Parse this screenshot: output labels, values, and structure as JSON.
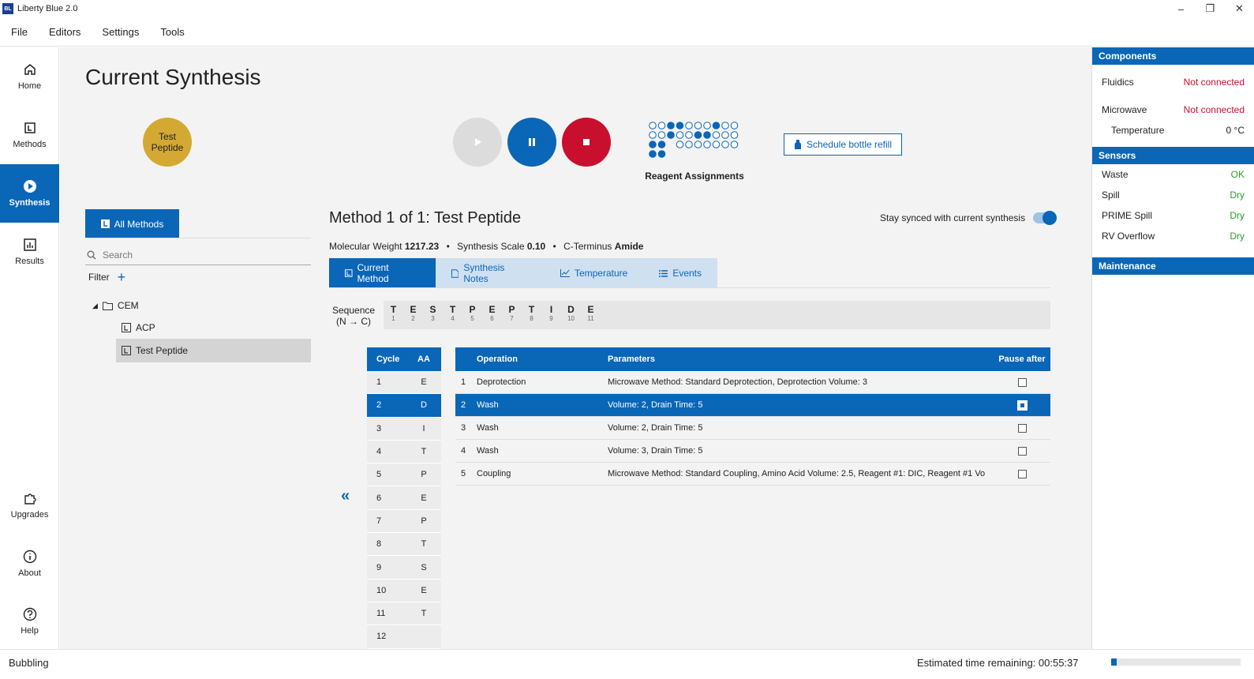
{
  "window": {
    "title": "Liberty Blue 2.0",
    "logo_text": "BL"
  },
  "menu": [
    "File",
    "Editors",
    "Settings",
    "Tools"
  ],
  "nav": [
    {
      "label": "Home",
      "icon": "home-icon"
    },
    {
      "label": "Methods",
      "icon": "method-icon"
    },
    {
      "label": "Synthesis",
      "icon": "play-circle-icon",
      "active": true
    },
    {
      "label": "Results",
      "icon": "bar-chart-icon"
    },
    {
      "label": "Upgrades",
      "icon": "puzzle-icon"
    },
    {
      "label": "About",
      "icon": "info-icon"
    },
    {
      "label": "Help",
      "icon": "help-icon"
    }
  ],
  "page": {
    "title": "Current Synthesis",
    "peptide_line1": "Test",
    "peptide_line2": "Peptide",
    "reagent_label": "Reagent Assignments",
    "refill_label": "Schedule bottle refill"
  },
  "methods": {
    "all_label": "All Methods",
    "search_placeholder": "Search",
    "filter_label": "Filter",
    "tree": {
      "folder": "CEM",
      "items": [
        "ACP",
        "Test Peptide"
      ],
      "selected": "Test Peptide"
    }
  },
  "method": {
    "title": "Method 1 of 1: Test Peptide",
    "sync_label": "Stay synced with current synthesis",
    "mw_label": "Molecular Weight",
    "mw_value": "1217.23",
    "scale_label": "Synthesis Scale",
    "scale_value": "0.10",
    "cterm_label": "C-Terminus",
    "cterm_value": "Amide",
    "tabs": [
      "Current Method",
      "Synthesis Notes",
      "Temperature",
      "Events"
    ]
  },
  "sequence": {
    "label_line1": "Sequence",
    "label_line2": "(N → C)",
    "residues": [
      "T",
      "E",
      "S",
      "T",
      "P",
      "E",
      "P",
      "T",
      "I",
      "D",
      "E"
    ],
    "positions": [
      "1",
      "2",
      "3",
      "4",
      "5",
      "6",
      "7",
      "8",
      "9",
      "10",
      "11"
    ]
  },
  "cycles": {
    "headers": [
      "Cycle",
      "AA"
    ],
    "rows": [
      [
        "1",
        "E"
      ],
      [
        "2",
        "D"
      ],
      [
        "3",
        "I"
      ],
      [
        "4",
        "T"
      ],
      [
        "5",
        "P"
      ],
      [
        "6",
        "E"
      ],
      [
        "7",
        "P"
      ],
      [
        "8",
        "T"
      ],
      [
        "9",
        "S"
      ],
      [
        "10",
        "E"
      ],
      [
        "11",
        "T"
      ],
      [
        "12",
        ""
      ]
    ],
    "selected_index": 1
  },
  "operations": {
    "headers": [
      "Operation",
      "Parameters",
      "Pause after"
    ],
    "rows": [
      {
        "n": "1",
        "op": "Deprotection",
        "params": "Microwave Method: Standard Deprotection, Deprotection Volume: 3"
      },
      {
        "n": "2",
        "op": "Wash",
        "params": "Volume: 2, Drain Time: 5"
      },
      {
        "n": "3",
        "op": "Wash",
        "params": "Volume: 2, Drain Time: 5"
      },
      {
        "n": "4",
        "op": "Wash",
        "params": "Volume: 3, Drain Time: 5"
      },
      {
        "n": "5",
        "op": "Coupling",
        "params": "Microwave Method: Standard Coupling, Amino Acid Volume: 2.5, Reagent #1: DIC, Reagent #1 Vo"
      }
    ],
    "selected_index": 1
  },
  "panel": {
    "components_title": "Components",
    "fluidics_label": "Fluidics",
    "fluidics_value": "Not connected",
    "microwave_label": "Microwave",
    "microwave_value": "Not connected",
    "temperature_label": "Temperature",
    "temperature_value": "0 °C",
    "sensors_title": "Sensors",
    "sensors": [
      {
        "label": "Waste",
        "value": "OK"
      },
      {
        "label": "Spill",
        "value": "Dry"
      },
      {
        "label": "PRIME Spill",
        "value": "Dry"
      },
      {
        "label": "RV Overflow",
        "value": "Dry"
      }
    ],
    "maintenance_title": "Maintenance"
  },
  "status": {
    "left": "Bubbling",
    "time_label": "Estimated time remaining: 00:55:37",
    "progress": 0.04
  },
  "colors": {
    "primary": "#0a66b7",
    "stop": "#c8102e",
    "peptide": "#d4a933",
    "ok": "#2a9d2a"
  }
}
